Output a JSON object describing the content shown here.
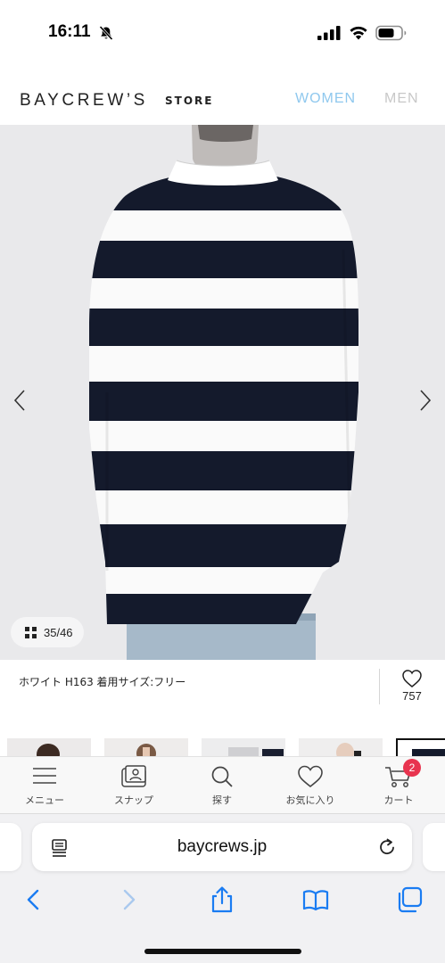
{
  "status_bar": {
    "time": "16:11"
  },
  "header": {
    "brand": "BAYCREW’S",
    "brand_suffix": "STORE",
    "nav": [
      {
        "label": "WOMEN",
        "color": "#8fc8ee"
      },
      {
        "label": "MEN",
        "color": "#c8c8c8"
      }
    ]
  },
  "product": {
    "image_counter": "35/46",
    "caption": "ホワイト H163 着用サイズ:フリー",
    "like_count": "757"
  },
  "tabbar": {
    "items": [
      {
        "label": "メニュー",
        "icon": "menu-icon"
      },
      {
        "label": "スナップ",
        "icon": "snap-icon"
      },
      {
        "label": "探す",
        "icon": "search-icon"
      },
      {
        "label": "お気に入り",
        "icon": "heart-icon"
      },
      {
        "label": "カート",
        "icon": "cart-icon"
      }
    ],
    "cart_badge": "2"
  },
  "browser": {
    "url": "baycrews.jp",
    "accent": "#1a7cf2"
  }
}
